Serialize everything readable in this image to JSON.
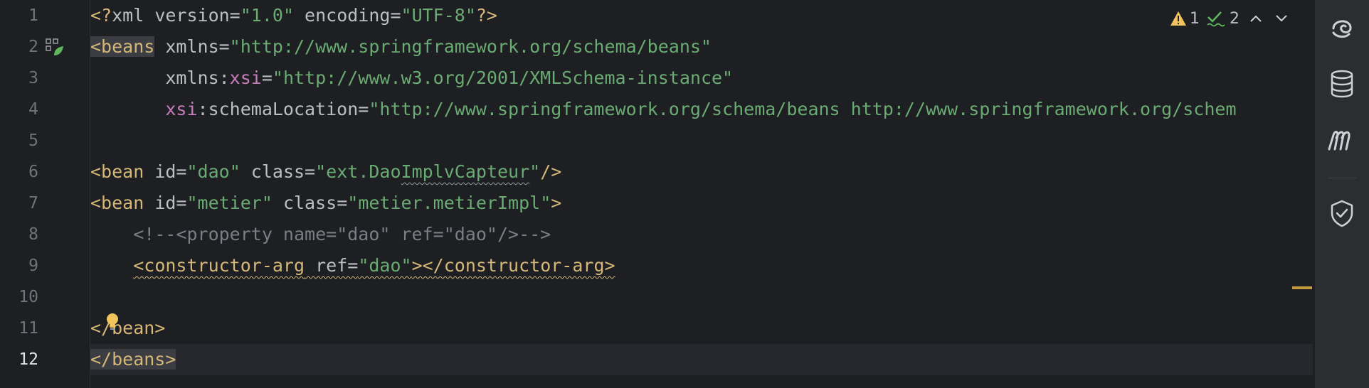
{
  "inspections": {
    "warnings": "1",
    "weak_warnings": "2"
  },
  "lines": [
    {
      "n": "1"
    },
    {
      "n": "2"
    },
    {
      "n": "3"
    },
    {
      "n": "4"
    },
    {
      "n": "5"
    },
    {
      "n": "6"
    },
    {
      "n": "7"
    },
    {
      "n": "8"
    },
    {
      "n": "9"
    },
    {
      "n": "10"
    },
    {
      "n": "11"
    },
    {
      "n": "12"
    }
  ],
  "code": {
    "l1": {
      "t1": "<?",
      "t2": "xml version=",
      "t3": "\"1.0\"",
      "t4": " encoding=",
      "t5": "\"UTF-8\"",
      "t6": "?>"
    },
    "l2": {
      "t1": "<beans",
      "t2": " xmlns=",
      "t3": "\"http://www.springframework.org/schema/beans\""
    },
    "l3": {
      "indent": "       ",
      "t1": "xmlns:",
      "t2": "xsi",
      "t3": "=",
      "t4": "\"http://www.w3.org/2001/XMLSchema-instance\""
    },
    "l4": {
      "indent": "       ",
      "t1": "xsi",
      "t2": ":schemaLocation=",
      "t3": "\"http://www.springframework.org/schema/beans http://www.springframework.org/schem"
    },
    "l6": {
      "t1": "<bean",
      "t2": " id=",
      "t3": "\"dao\"",
      "t4": " class=",
      "t5": "\"ext.Dao",
      "t6": "Implv",
      "t7": "Capteur",
      "t8": "\"",
      "t9": "/>"
    },
    "l7": {
      "t1": "<bean",
      "t2": " id=",
      "t3": "\"metier\"",
      "t4": " class=",
      "t5": "\"metier.metierImpl\"",
      "t6": ">"
    },
    "l8": {
      "indent": "    ",
      "t1": "<!--<property name=\"dao\" ref=\"dao\"/>-->"
    },
    "l9": {
      "indent": "    ",
      "t1": "<constructor-arg",
      "t2": " ref=",
      "t3": "\"dao\"",
      "t4": "></constructor-arg>"
    },
    "l11": {
      "t1": "</bean>"
    },
    "l12": {
      "t1": "</beans>"
    }
  }
}
